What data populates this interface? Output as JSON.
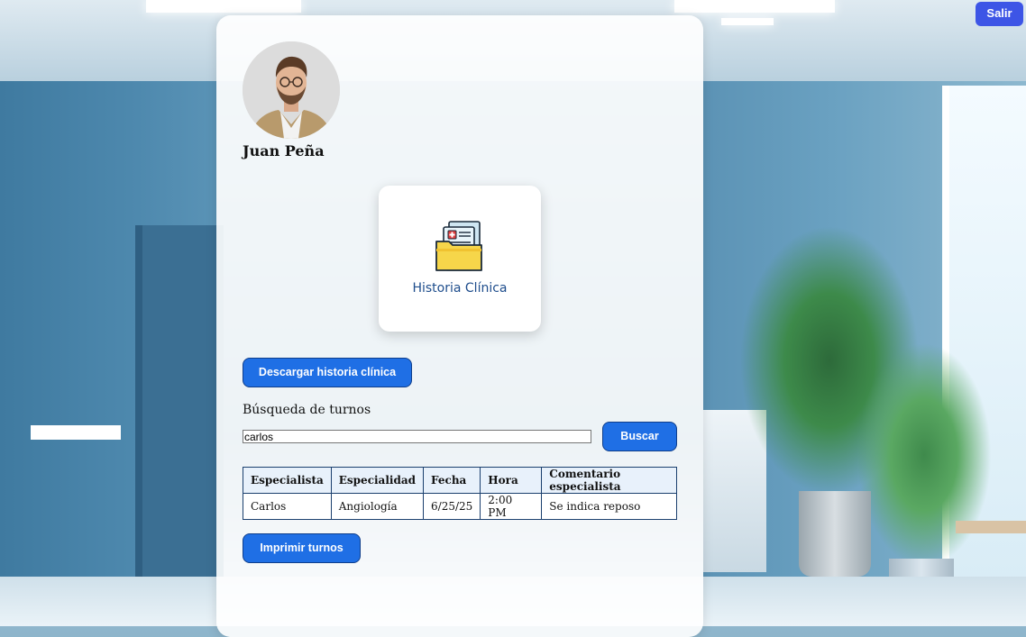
{
  "user": {
    "name": "Juan Peña"
  },
  "module": {
    "label": "Historia Clínica",
    "icon": "medical-folder-icon"
  },
  "actions": {
    "download_label": "Descargar historia clínica",
    "print_label": "Imprimir turnos",
    "exit_label": "Salir"
  },
  "search": {
    "label": "Búsqueda de turnos",
    "value": "carlos",
    "button_label": "Buscar"
  },
  "table": {
    "headers": [
      "Especialista",
      "Especialidad",
      "Fecha",
      "Hora",
      "Comentario especialista"
    ],
    "rows": [
      [
        "Carlos",
        "Angiología",
        "6/25/25",
        "2:00 PM",
        "Se indica reposo"
      ]
    ]
  },
  "colors": {
    "primary_button": "#1f6fe5",
    "exit_button": "#3d55e6",
    "module_label": "#1e4d8c"
  }
}
